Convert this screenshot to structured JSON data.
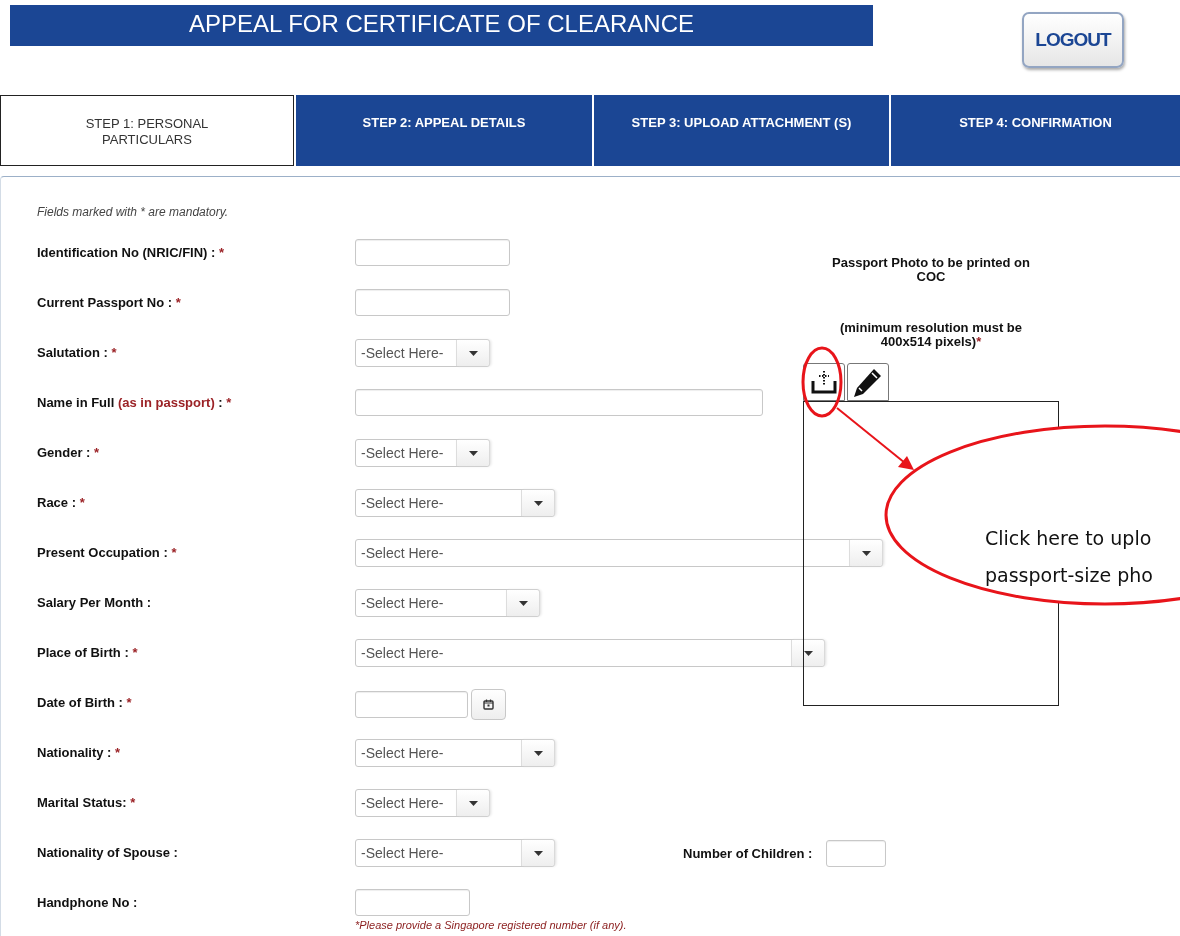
{
  "header": {
    "title": "APPEAL FOR CERTIFICATE OF CLEARANCE",
    "logout": "LOGOUT"
  },
  "steps": [
    {
      "label": "STEP 1: PERSONAL PARTICULARS",
      "selected": true
    },
    {
      "label": "STEP 2: APPEAL DETAILS",
      "selected": false
    },
    {
      "label": "STEP 3: UPLOAD ATTACHMENT (S)",
      "selected": false
    },
    {
      "label": "STEP 4: CONFIRMATION",
      "selected": false
    }
  ],
  "form": {
    "mandatory_note": "Fields marked with * are mandatory.",
    "fields": [
      {
        "label": "Identification No (NRIC/FIN) :",
        "required_mark": "*",
        "kind": "input"
      },
      {
        "label": "Current Passport No :",
        "required_mark": "*",
        "kind": "input"
      },
      {
        "label": "Salutation :",
        "required_mark": "*",
        "kind": "select-small",
        "placeholder": "-Select Here-"
      },
      {
        "label": "Name in Full",
        "label_note": "(as in passport)",
        "label_end": ":",
        "required_mark": "*",
        "kind": "wide-input"
      },
      {
        "label": "Gender :",
        "required_mark": "*",
        "kind": "select-small",
        "placeholder": "-Select Here-"
      },
      {
        "label": "Race :",
        "required_mark": "*",
        "kind": "select-medium",
        "placeholder": "-Select Here-"
      },
      {
        "label": "Present Occupation :",
        "required_mark": "*",
        "kind": "select-full",
        "placeholder": "-Select Here-"
      },
      {
        "label": "Salary Per Month :",
        "kind": "select-mid",
        "placeholder": "-Select Here-"
      },
      {
        "label": "Place of Birth :",
        "required_mark": "*",
        "kind": "select-wide",
        "placeholder": "-Select Here-"
      },
      {
        "label": "Date of Birth :",
        "required_mark": "*",
        "kind": "date"
      },
      {
        "label": "Nationality :",
        "required_mark": "*",
        "kind": "select-medium",
        "placeholder": "-Select Here-"
      },
      {
        "label": "Marital Status:",
        "required_mark": "*",
        "kind": "select-small",
        "placeholder": "-Select Here-"
      },
      {
        "label": "Nationality of Spouse :",
        "kind": "select-medium",
        "placeholder": "-Select Here-",
        "side_field": {
          "label": "Number of Children :"
        }
      },
      {
        "label": "Handphone No :",
        "kind": "input-short",
        "note": "*Please provide a Singapore registered number (if any)."
      }
    ]
  },
  "photo": {
    "heading": "Passport Photo to be printed on COC",
    "requirement": "(minimum resolution must be 400x514 pixels)",
    "required_mark": "*"
  },
  "callout": {
    "lines": [
      "Click here to uplo",
      "passport-size pho"
    ]
  }
}
